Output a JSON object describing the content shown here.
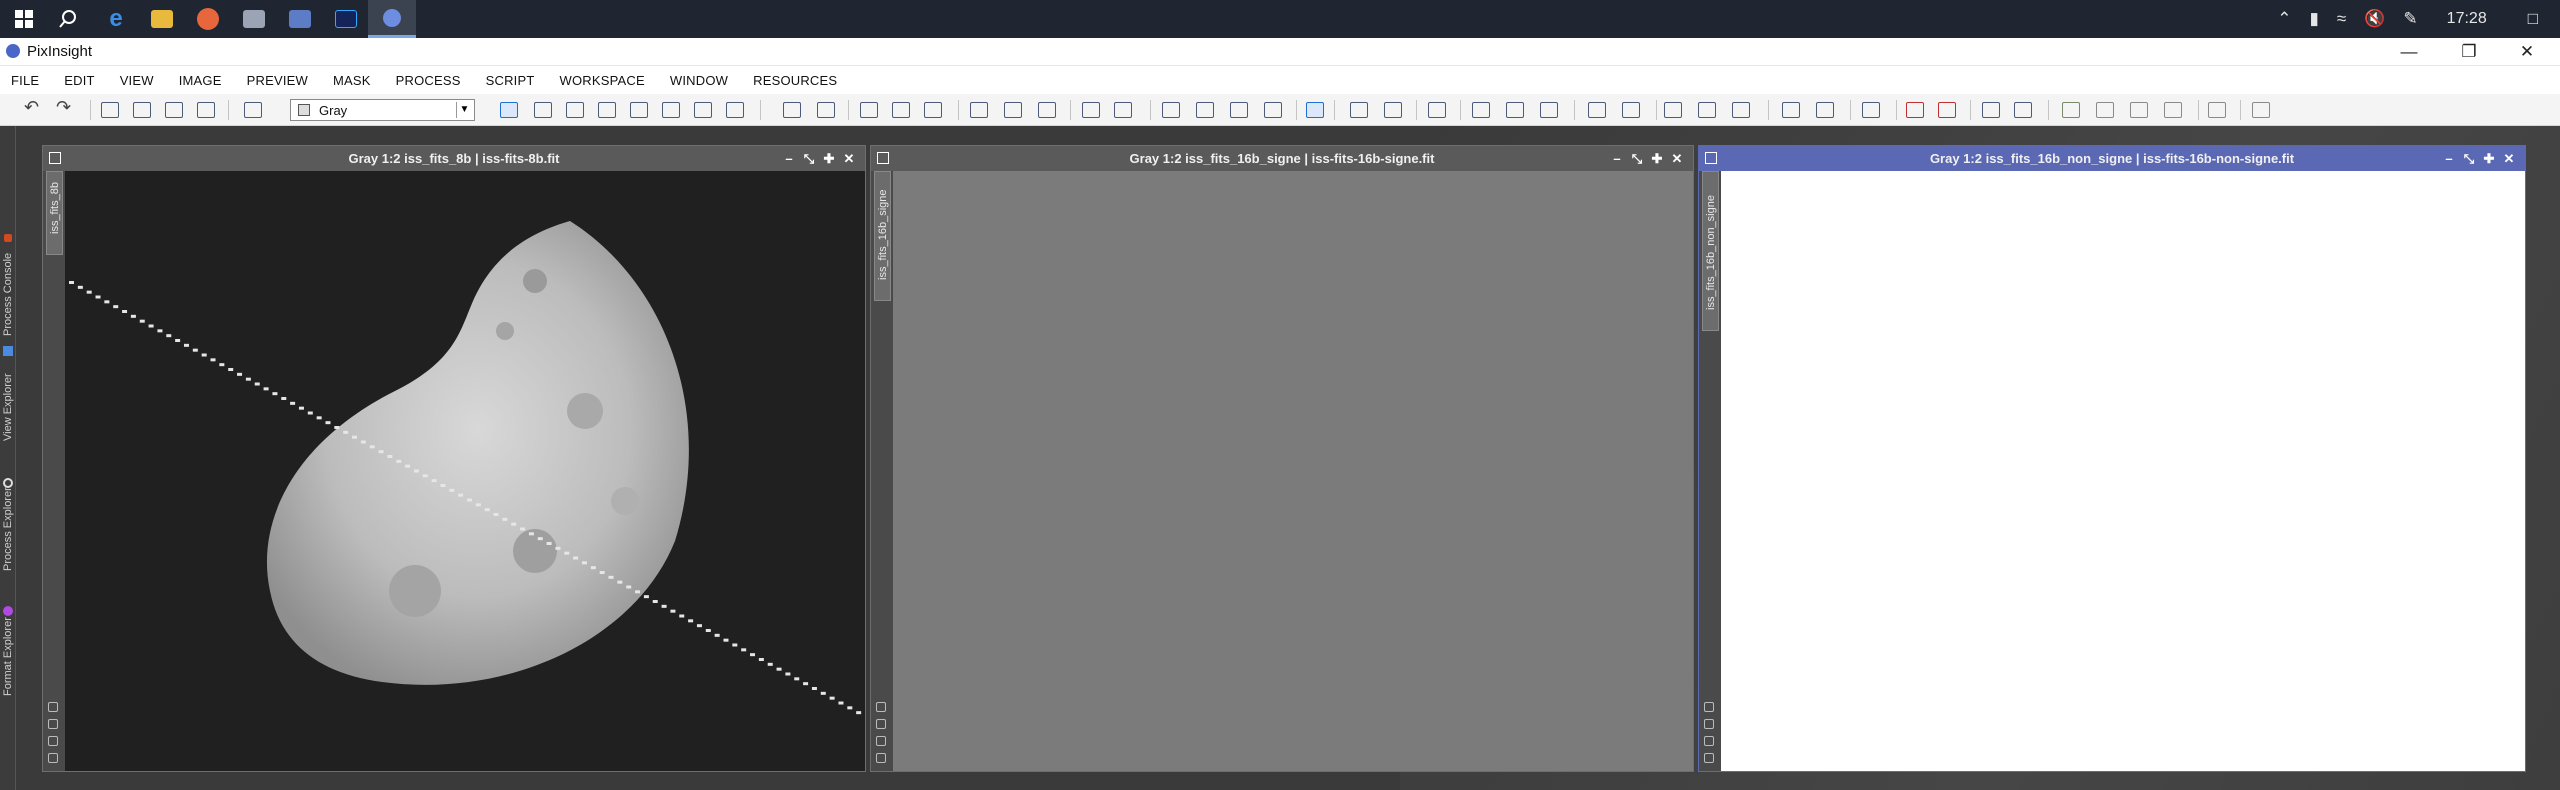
{
  "taskbar": {
    "icons": [
      "windows-start-icon",
      "search-icon",
      "edge-browser-icon",
      "file-explorer-icon",
      "firefox-icon",
      "remote-desktop-icon",
      "network-app-icon",
      "photoshop-icon",
      "pixinsight-icon"
    ],
    "tray_icons": [
      "chevron-up-icon",
      "battery-icon",
      "wifi-icon",
      "volume-muted-icon",
      "pen-icon"
    ],
    "clock": "17:28",
    "notification_icon": "notification-icon"
  },
  "window": {
    "title": "PixInsight"
  },
  "menu": {
    "items": [
      "FILE",
      "EDIT",
      "VIEW",
      "IMAGE",
      "PREVIEW",
      "MASK",
      "PROCESS",
      "SCRIPT",
      "WORKSPACE",
      "WINDOW",
      "RESOURCES"
    ]
  },
  "toolbar": {
    "channel_combo_value": "Gray"
  },
  "explorer_tabs": [
    "Process Console",
    "View Explorer",
    "Process Explorer",
    "Format Explorer"
  ],
  "images": [
    {
      "title": "Gray 1:2 iss_fits_8b | iss-fits-8b.fit",
      "id": "iss_fits_8b",
      "content": "moon"
    },
    {
      "title": "Gray 1:2 iss_fits_16b_signe | iss-fits-16b-signe.fit",
      "id": "iss_fits_16b_signe",
      "content": "gray"
    },
    {
      "title": "Gray 1:2 iss_fits_16b_non_signe | iss-fits-16b-non-signe.fit",
      "id": "iss_fits_16b_non_signe",
      "content": "white"
    }
  ],
  "window_buttons": [
    "–",
    "⤡",
    "✚",
    "✕"
  ],
  "colors": {
    "active_title": "#5b68b4",
    "inactive_title": "#5a5a5a",
    "taskbar": "#1f2531"
  }
}
